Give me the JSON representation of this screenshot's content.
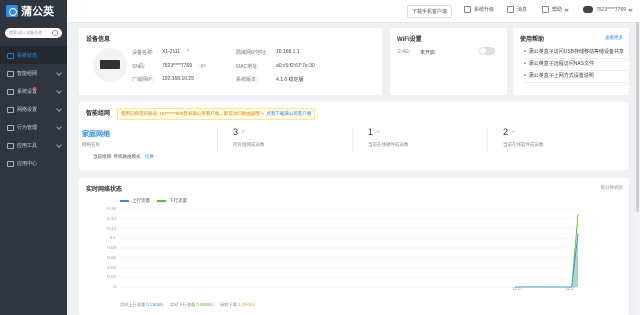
{
  "app": {
    "logo_text": "蒲公英"
  },
  "sidebar": {
    "search_placeholder": "搜索/进入设备名称",
    "items": [
      {
        "label": "系统状态",
        "icon": "dashboard-icon",
        "active": true,
        "chevron": false,
        "dot": false
      },
      {
        "label": "智能组网",
        "icon": "network-icon",
        "active": false,
        "chevron": true,
        "dot": false
      },
      {
        "label": "系统设置",
        "icon": "settings-icon",
        "active": false,
        "chevron": true,
        "dot": true
      },
      {
        "label": "网络设置",
        "icon": "globe-icon",
        "active": false,
        "chevron": true,
        "dot": false
      },
      {
        "label": "行为管理",
        "icon": "shield-icon",
        "active": false,
        "chevron": true,
        "dot": false
      },
      {
        "label": "应用工具",
        "icon": "tools-icon",
        "active": false,
        "chevron": true,
        "dot": false
      },
      {
        "label": "应用中心",
        "icon": "apps-icon",
        "active": false,
        "chevron": false,
        "dot": false
      }
    ]
  },
  "topbar": {
    "download_app": "下载手机客户端",
    "system_upgrade": "系统升级",
    "messages": "消息",
    "help": "帮助",
    "user": "7523****7769"
  },
  "device": {
    "title": "设备信息",
    "name_label": "设备名称:",
    "name_value": "X1-2111",
    "sn_label": "SN码:",
    "sn_value": "7523****7769",
    "sn_suffix": "-gx",
    "wan_label": "广域网IP:",
    "wan_value": "192.168.10.25",
    "lan_label": "局域网IP地址:",
    "lan_value": "10.168.1.1",
    "mac_label": "MAC地址:",
    "mac_value": "a0:c5:f2:67:7e:30",
    "version_label": "系统版本:",
    "version_value": "4.1.0 稳定版"
  },
  "wifi": {
    "title": "WiFi设置",
    "band": "2.4G:",
    "status": "未开启"
  },
  "help_card": {
    "title": "使用帮助",
    "more": "查看更多",
    "items": [
      "蒲公英盒子访问USB存储移动等储设备共享",
      "蒲公英盒子远程访问NAS文件",
      "蒲公英盒子上网方式设置说明"
    ]
  },
  "smartnet": {
    "title": "智能组网",
    "notice": "使用已绑定的账号: 157*****809登录蒲公英客户端，即可访问路由器哦～",
    "notice_link": "点我下载蒲公英客户端",
    "home_name": "家庭网络",
    "home_desc": "网络名称",
    "members": "3",
    "members_desc": "所有组网成员数",
    "hardware": "1",
    "hardware_desc": "当前在线硬件成员数",
    "software": "2",
    "software_desc": "当前在线软件成员数",
    "mode_label": "当前组网: 传统路由模式",
    "mode_switch": "切换"
  },
  "realtime": {
    "title": "实时网络状态",
    "more": "每分钟刷新",
    "legend_up": "上行流量",
    "legend_down": "下行流量",
    "up_color": "#2d8cf0",
    "down_color": "#52c41a",
    "time_left": "11:27",
    "time_right": "11:27",
    "foot_up": "实时上行流量",
    "foot_up_val": "0.11KB/s",
    "foot_down": "实时下行流量",
    "foot_down_val": "0.06KB/s",
    "foot_total": "接收下载",
    "foot_total_val": "2.06KB/s"
  },
  "chart_data": {
    "type": "area",
    "title": "",
    "ylabel": "",
    "ylim": [
      0,
      0.16
    ],
    "yticks": [
      "0.16",
      "0.14",
      "0.12",
      "0.1",
      "0.08",
      "0.06",
      "0.04",
      "0.02",
      "0"
    ],
    "series": [
      {
        "name": "上行流量",
        "values": [
          0,
          0,
          0,
          0,
          0,
          0,
          0,
          0,
          0,
          0,
          0.11
        ]
      },
      {
        "name": "下行流量",
        "values": [
          0,
          0,
          0,
          0,
          0,
          0,
          0,
          0,
          0,
          0,
          0.15
        ]
      }
    ]
  }
}
